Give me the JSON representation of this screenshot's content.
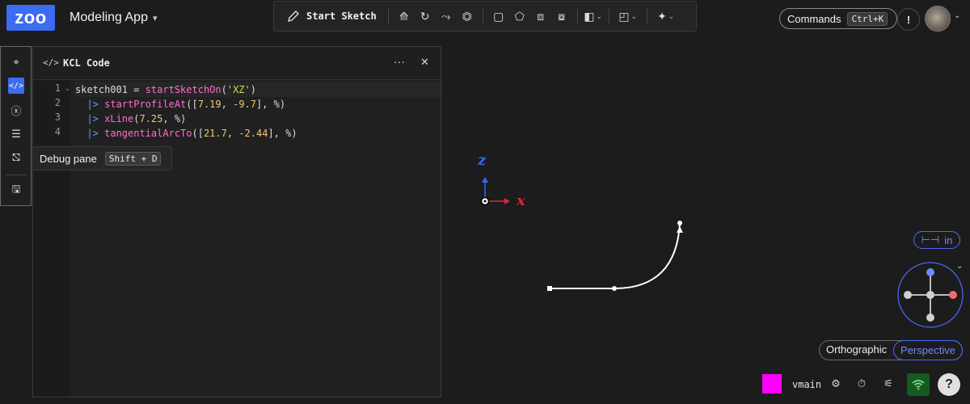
{
  "app": {
    "logo_text": "zoo",
    "title": "Modeling App",
    "title_chevron": "⌄"
  },
  "toolbar": {
    "start_sketch_label": "Start Sketch",
    "start_sketch_icon": "pencil-icon",
    "icons": [
      "extrude-icon",
      "revolve-icon",
      "sweep-icon",
      "loft-icon",
      "fillet-icon",
      "chamfer-icon",
      "shell-icon",
      "hole-icon",
      "boolean-icon",
      "plane-icon",
      "ai-sparkle-icon"
    ]
  },
  "header_right": {
    "commands_label": "Commands",
    "commands_shortcut": "Ctrl+K",
    "notify_label": "!"
  },
  "sidebar": {
    "items": [
      {
        "name": "feature-tree",
        "icon": "layers-icon"
      },
      {
        "name": "kcl-code",
        "icon": "code-icon",
        "active": true
      },
      {
        "name": "variables",
        "icon": "function-icon"
      },
      {
        "name": "logs",
        "icon": "list-icon"
      },
      {
        "name": "debug-pane",
        "icon": "debug-icon"
      },
      {
        "name": "export",
        "icon": "save-icon"
      }
    ]
  },
  "pane": {
    "title": "KCL Code",
    "icon_glyph": "</>",
    "more_label": "···",
    "close_label": "✕"
  },
  "code": {
    "lines": [
      {
        "n": "1",
        "fold": "⌄",
        "tokens": [
          [
            "t-var",
            "sketch001 = "
          ],
          [
            "t-fn",
            "startSketchOn"
          ],
          [
            "t-var",
            "("
          ],
          [
            "t-str",
            "'XZ'"
          ],
          [
            "t-var",
            ")"
          ]
        ]
      },
      {
        "n": "2",
        "fold": "",
        "tokens": [
          [
            "t-pipe",
            "  |> "
          ],
          [
            "t-fn",
            "startProfileAt"
          ],
          [
            "t-var",
            "(["
          ],
          [
            "t-num",
            "7.19"
          ],
          [
            "t-var",
            ", "
          ],
          [
            "t-num",
            "-9.7"
          ],
          [
            "t-var",
            "], %)"
          ]
        ]
      },
      {
        "n": "3",
        "fold": "",
        "tokens": [
          [
            "t-pipe",
            "  |> "
          ],
          [
            "t-fn",
            "xLine"
          ],
          [
            "t-var",
            "("
          ],
          [
            "t-num",
            "7.25"
          ],
          [
            "t-var",
            ", %)"
          ]
        ]
      },
      {
        "n": "4",
        "fold": "",
        "tokens": [
          [
            "t-pipe",
            "  |> "
          ],
          [
            "t-fn",
            "tangentialArcTo"
          ],
          [
            "t-var",
            "(["
          ],
          [
            "t-num",
            "21.7"
          ],
          [
            "t-var",
            ", "
          ],
          [
            "t-num",
            "-2.44"
          ],
          [
            "t-var",
            "], %)"
          ]
        ]
      }
    ]
  },
  "tooltip": {
    "label": "Debug pane",
    "shortcut": "Shift + D"
  },
  "viewport": {
    "axis_z_label": "z",
    "axis_x_label": "x",
    "axis_z_color": "#2f6bff",
    "axis_x_color": "#e0243a",
    "unit_label": "in",
    "projection_ortho": "Orthographic",
    "projection_persp": "Perspective",
    "projection_active": "Perspective"
  },
  "status": {
    "swatch_color": "#ff00ff",
    "branch": "vmain",
    "help_label": "?"
  }
}
